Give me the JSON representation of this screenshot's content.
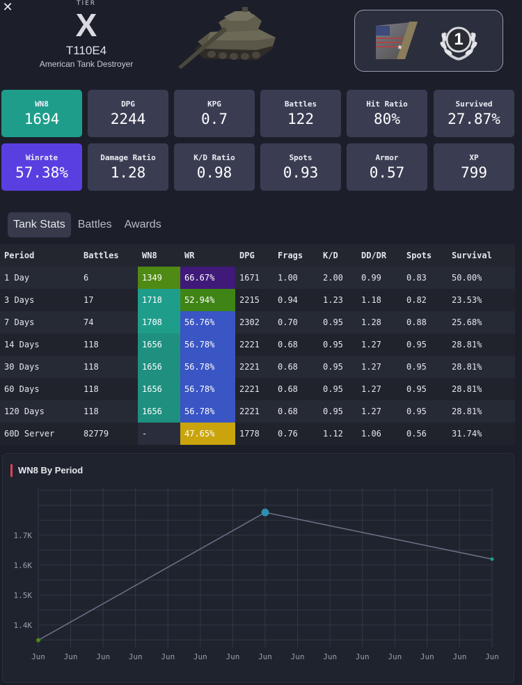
{
  "header": {
    "close_label": "✕",
    "tier_label": "TIER",
    "tier_value": "X",
    "tank_name": "T110E4",
    "tank_class": "American Tank Destroyer",
    "mastery_number": "1"
  },
  "tiles": [
    {
      "label": "WN8",
      "value": "1694",
      "color": "#1f9d8b"
    },
    {
      "label": "DPG",
      "value": "2244",
      "color": "#3a3d52"
    },
    {
      "label": "KPG",
      "value": "0.7",
      "color": "#3a3d52"
    },
    {
      "label": "Battles",
      "value": "122",
      "color": "#3a3d52"
    },
    {
      "label": "Hit Ratio",
      "value": "80%",
      "color": "#3a3d52"
    },
    {
      "label": "Survived",
      "value": "27.87%",
      "color": "#3a3d52"
    },
    {
      "label": "Winrate",
      "value": "57.38%",
      "color": "#5a3fe0"
    },
    {
      "label": "Damage Ratio",
      "value": "1.28",
      "color": "#3a3d52"
    },
    {
      "label": "K/D Ratio",
      "value": "0.98",
      "color": "#3a3d52"
    },
    {
      "label": "Spots",
      "value": "0.93",
      "color": "#3a3d52"
    },
    {
      "label": "Armor",
      "value": "0.57",
      "color": "#3a3d52"
    },
    {
      "label": "XP",
      "value": "799",
      "color": "#3a3d52"
    }
  ],
  "tabs": [
    {
      "label": "Tank Stats",
      "active": true
    },
    {
      "label": "Battles",
      "active": false
    },
    {
      "label": "Awards",
      "active": false
    }
  ],
  "table": {
    "headers": [
      "Period",
      "Battles",
      "WN8",
      "WR",
      "DPG",
      "Frags",
      "K/D",
      "DD/DR",
      "Spots",
      "Survival"
    ],
    "rows": [
      {
        "period": "1 Day",
        "battles": "6",
        "wn8": "1349",
        "wn8_color": "#4e8a14",
        "wr": "66.67%",
        "wr_color": "#3f1a78",
        "dpg": "1671",
        "frags": "1.00",
        "kd": "2.00",
        "dddr": "0.99",
        "spots": "0.83",
        "survival": "50.00%"
      },
      {
        "period": "3 Days",
        "battles": "17",
        "wn8": "1718",
        "wn8_color": "#1f9d8b",
        "wr": "52.94%",
        "wr_color": "#3f8515",
        "dpg": "2215",
        "frags": "0.94",
        "kd": "1.23",
        "dddr": "1.18",
        "spots": "0.82",
        "survival": "23.53%"
      },
      {
        "period": "7 Days",
        "battles": "74",
        "wn8": "1708",
        "wn8_color": "#1f9d8b",
        "wr": "56.76%",
        "wr_color": "#3a55c4",
        "dpg": "2302",
        "frags": "0.70",
        "kd": "0.95",
        "dddr": "1.28",
        "spots": "0.88",
        "survival": "25.68%"
      },
      {
        "period": "14 Days",
        "battles": "118",
        "wn8": "1656",
        "wn8_color": "#1f9080",
        "wr": "56.78%",
        "wr_color": "#3a55c4",
        "dpg": "2221",
        "frags": "0.68",
        "kd": "0.95",
        "dddr": "1.27",
        "spots": "0.95",
        "survival": "28.81%"
      },
      {
        "period": "30 Days",
        "battles": "118",
        "wn8": "1656",
        "wn8_color": "#1f9080",
        "wr": "56.78%",
        "wr_color": "#3a55c4",
        "dpg": "2221",
        "frags": "0.68",
        "kd": "0.95",
        "dddr": "1.27",
        "spots": "0.95",
        "survival": "28.81%"
      },
      {
        "period": "60 Days",
        "battles": "118",
        "wn8": "1656",
        "wn8_color": "#1f9080",
        "wr": "56.78%",
        "wr_color": "#3a55c4",
        "dpg": "2221",
        "frags": "0.68",
        "kd": "0.95",
        "dddr": "1.27",
        "spots": "0.95",
        "survival": "28.81%"
      },
      {
        "period": "120 Days",
        "battles": "118",
        "wn8": "1656",
        "wn8_color": "#1f9080",
        "wr": "56.78%",
        "wr_color": "#3a55c4",
        "dpg": "2221",
        "frags": "0.68",
        "kd": "0.95",
        "dddr": "1.27",
        "spots": "0.95",
        "survival": "28.81%"
      },
      {
        "period": "60D Server",
        "battles": "82779",
        "wn8": "-",
        "wn8_color": "#2a2d3b",
        "wr": "47.65%",
        "wr_color": "#c9a40c",
        "dpg": "1778",
        "frags": "0.76",
        "kd": "1.12",
        "dddr": "1.06",
        "spots": "0.56",
        "survival": "31.74%"
      }
    ]
  },
  "chart_data": {
    "type": "line",
    "title": "WN8 By Period",
    "x_tick_labels": [
      "Jun",
      "Jun",
      "Jun",
      "Jun",
      "Jun",
      "Jun",
      "Jun",
      "Jun",
      "Jun",
      "Jun",
      "Jun",
      "Jun",
      "Jun",
      "Jun",
      "Jun"
    ],
    "y_tick_labels": [
      "1.4K",
      "1.5K",
      "1.6K",
      "1.7K"
    ],
    "y_ticks": [
      1400,
      1500,
      1600,
      1700
    ],
    "ylim": [
      1325,
      1860
    ],
    "x_count": 15,
    "points": [
      {
        "x_index": 0,
        "value": 1349,
        "color": "#4e8a14"
      },
      {
        "x_index": 7,
        "value": 1776,
        "color": "#2e8fb0"
      },
      {
        "x_index": 14,
        "value": 1620,
        "color": "#1f9d8b"
      }
    ],
    "grid": true,
    "line_color": "#6b6f87"
  }
}
